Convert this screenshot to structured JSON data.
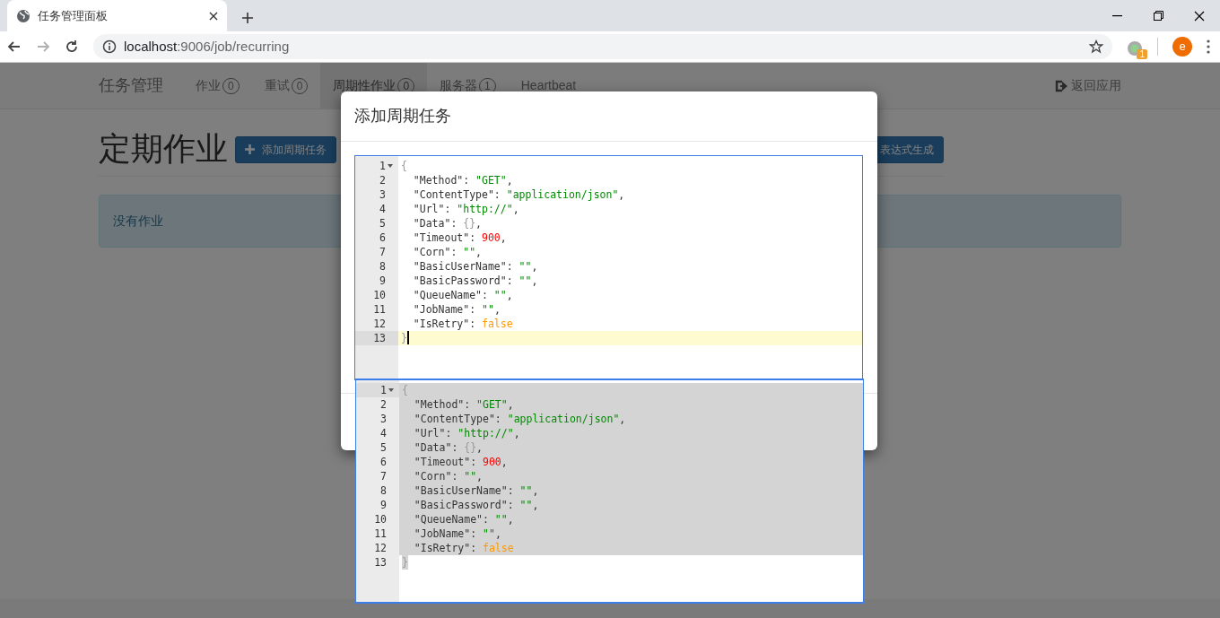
{
  "browser": {
    "tab": {
      "title": "任务管理面板"
    },
    "nav_buttons": [
      {
        "kind": "back",
        "disabled": false
      },
      {
        "kind": "forward",
        "disabled": true
      },
      {
        "kind": "reload",
        "disabled": false
      }
    ],
    "address": {
      "host": "localhost",
      "path": ":9006/job/recurring"
    },
    "extension_badge": "1",
    "profile_initial": "e"
  },
  "navbar": {
    "brand": "任务管理",
    "items": [
      {
        "label": "作业",
        "count": "0",
        "selected": false
      },
      {
        "label": "重试",
        "count": "0",
        "selected": false
      },
      {
        "label": "周期性作业",
        "count": "0",
        "selected": true
      },
      {
        "label": "服务器",
        "count": "1",
        "selected": false
      },
      {
        "label": "Heartbeat",
        "selected": false
      }
    ],
    "return_link": "返回应用"
  },
  "page": {
    "title": "定期作业",
    "buttons": [
      {
        "kind": "add",
        "label": "添加周期任务"
      },
      {
        "kind": "plain",
        "label": "表达式生成"
      }
    ],
    "alert": "没有作业"
  },
  "modal": {
    "title": "添加周期任务",
    "editors": [
      {
        "kind": "inline",
        "selected": false,
        "cursor": true,
        "lines": [
          {
            "number": "1",
            "foldable": true,
            "active": false,
            "tokens": [
              {
                "kind": "brace",
                "text": "{"
              }
            ]
          },
          {
            "number": "2",
            "foldable": false,
            "active": false,
            "tokens": [
              {
                "kind": "plain",
                "text": "  \"Method\": "
              },
              {
                "kind": "string",
                "text": "\"GET\""
              },
              {
                "kind": "plain",
                "text": ","
              }
            ]
          },
          {
            "number": "3",
            "foldable": false,
            "active": false,
            "tokens": [
              {
                "kind": "plain",
                "text": "  \"ContentType\": "
              },
              {
                "kind": "string",
                "text": "\"application/json\""
              },
              {
                "kind": "plain",
                "text": ","
              }
            ]
          },
          {
            "number": "4",
            "foldable": false,
            "active": false,
            "tokens": [
              {
                "kind": "plain",
                "text": "  \"Url\": "
              },
              {
                "kind": "string",
                "text": "\"http://\""
              },
              {
                "kind": "plain",
                "text": ","
              }
            ]
          },
          {
            "number": "5",
            "foldable": false,
            "active": false,
            "tokens": [
              {
                "kind": "plain",
                "text": "  \"Data\": "
              },
              {
                "kind": "brace",
                "text": "{}"
              },
              {
                "kind": "plain",
                "text": ","
              }
            ]
          },
          {
            "number": "6",
            "foldable": false,
            "active": false,
            "tokens": [
              {
                "kind": "plain",
                "text": "  \"Timeout\": "
              },
              {
                "kind": "number",
                "text": "900"
              },
              {
                "kind": "plain",
                "text": ","
              }
            ]
          },
          {
            "number": "7",
            "foldable": false,
            "active": false,
            "tokens": [
              {
                "kind": "plain",
                "text": "  \"Corn\": "
              },
              {
                "kind": "string",
                "text": "\"\""
              },
              {
                "kind": "plain",
                "text": ","
              }
            ]
          },
          {
            "number": "8",
            "foldable": false,
            "active": false,
            "tokens": [
              {
                "kind": "plain",
                "text": "  \"BasicUserName\": "
              },
              {
                "kind": "string",
                "text": "\"\""
              },
              {
                "kind": "plain",
                "text": ","
              }
            ]
          },
          {
            "number": "9",
            "foldable": false,
            "active": false,
            "tokens": [
              {
                "kind": "plain",
                "text": "  \"BasicPassword\": "
              },
              {
                "kind": "string",
                "text": "\"\""
              },
              {
                "kind": "plain",
                "text": ","
              }
            ]
          },
          {
            "number": "10",
            "foldable": false,
            "active": false,
            "tokens": [
              {
                "kind": "plain",
                "text": "  \"QueueName\": "
              },
              {
                "kind": "string",
                "text": "\"\""
              },
              {
                "kind": "plain",
                "text": ","
              }
            ]
          },
          {
            "number": "11",
            "foldable": false,
            "active": false,
            "tokens": [
              {
                "kind": "plain",
                "text": "  \"JobName\": "
              },
              {
                "kind": "string",
                "text": "\"\""
              },
              {
                "kind": "plain",
                "text": ","
              }
            ]
          },
          {
            "number": "12",
            "foldable": false,
            "active": false,
            "tokens": [
              {
                "kind": "plain",
                "text": "  \"IsRetry\": "
              },
              {
                "kind": "boolean",
                "text": "false"
              }
            ]
          },
          {
            "number": "13",
            "foldable": false,
            "active": true,
            "tokens": [
              {
                "kind": "brace",
                "text": "}"
              }
            ]
          }
        ]
      },
      {
        "kind": "floating",
        "selected": true,
        "cursor": false,
        "lines": [
          {
            "number": "1",
            "foldable": true,
            "active": true,
            "tokens": [
              {
                "kind": "brace",
                "text": "{"
              }
            ]
          },
          {
            "number": "2",
            "foldable": false,
            "active": false,
            "tokens": [
              {
                "kind": "plain",
                "text": "  \"Method\": "
              },
              {
                "kind": "string",
                "text": "\"GET\""
              },
              {
                "kind": "plain",
                "text": ","
              }
            ]
          },
          {
            "number": "3",
            "foldable": false,
            "active": false,
            "tokens": [
              {
                "kind": "plain",
                "text": "  \"ContentType\": "
              },
              {
                "kind": "string",
                "text": "\"application/json\""
              },
              {
                "kind": "plain",
                "text": ","
              }
            ]
          },
          {
            "number": "4",
            "foldable": false,
            "active": false,
            "tokens": [
              {
                "kind": "plain",
                "text": "  \"Url\": "
              },
              {
                "kind": "string",
                "text": "\"http://\""
              },
              {
                "kind": "plain",
                "text": ","
              }
            ]
          },
          {
            "number": "5",
            "foldable": false,
            "active": false,
            "tokens": [
              {
                "kind": "plain",
                "text": "  \"Data\": "
              },
              {
                "kind": "brace",
                "text": "{}"
              },
              {
                "kind": "plain",
                "text": ","
              }
            ]
          },
          {
            "number": "6",
            "foldable": false,
            "active": false,
            "tokens": [
              {
                "kind": "plain",
                "text": "  \"Timeout\": "
              },
              {
                "kind": "number",
                "text": "900"
              },
              {
                "kind": "plain",
                "text": ","
              }
            ]
          },
          {
            "number": "7",
            "foldable": false,
            "active": false,
            "tokens": [
              {
                "kind": "plain",
                "text": "  \"Corn\": "
              },
              {
                "kind": "string",
                "text": "\"\""
              },
              {
                "kind": "plain",
                "text": ","
              }
            ]
          },
          {
            "number": "8",
            "foldable": false,
            "active": false,
            "tokens": [
              {
                "kind": "plain",
                "text": "  \"BasicUserName\": "
              },
              {
                "kind": "string",
                "text": "\"\""
              },
              {
                "kind": "plain",
                "text": ","
              }
            ]
          },
          {
            "number": "9",
            "foldable": false,
            "active": false,
            "tokens": [
              {
                "kind": "plain",
                "text": "  \"BasicPassword\": "
              },
              {
                "kind": "string",
                "text": "\"\""
              },
              {
                "kind": "plain",
                "text": ","
              }
            ]
          },
          {
            "number": "10",
            "foldable": false,
            "active": false,
            "tokens": [
              {
                "kind": "plain",
                "text": "  \"QueueName\": "
              },
              {
                "kind": "string",
                "text": "\"\""
              },
              {
                "kind": "plain",
                "text": ","
              }
            ]
          },
          {
            "number": "11",
            "foldable": false,
            "active": false,
            "tokens": [
              {
                "kind": "plain",
                "text": "  \"JobName\": "
              },
              {
                "kind": "string",
                "text": "\"\""
              },
              {
                "kind": "plain",
                "text": ","
              }
            ]
          },
          {
            "number": "12",
            "foldable": false,
            "active": false,
            "tokens": [
              {
                "kind": "plain",
                "text": "  \"IsRetry\": "
              },
              {
                "kind": "boolean",
                "text": "false"
              }
            ]
          },
          {
            "number": "13",
            "foldable": false,
            "active": false,
            "tokens": [
              {
                "kind": "brace",
                "text": "}"
              }
            ]
          }
        ]
      }
    ]
  }
}
